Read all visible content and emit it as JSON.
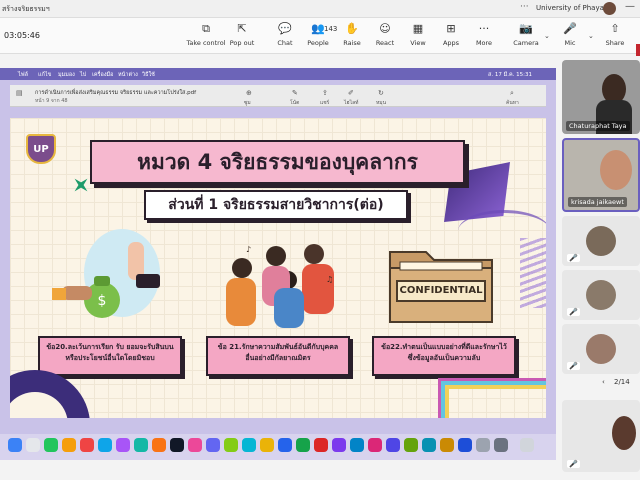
{
  "titlebar": {
    "title": "สร้างจริยธรรมฯ",
    "org": "University of Phayao",
    "more": "···",
    "minimize": "—"
  },
  "meeting": {
    "timer": "03:05:46",
    "tools": [
      {
        "label": "Take control",
        "icon": "take-control-icon",
        "glyph": "⧉"
      },
      {
        "label": "Pop out",
        "icon": "pop-out-icon",
        "glyph": "⇱"
      },
      {
        "label": "Chat",
        "icon": "chat-icon",
        "glyph": "💬"
      },
      {
        "label": "People",
        "icon": "people-icon",
        "glyph": "👥",
        "count": "143"
      },
      {
        "label": "Raise",
        "icon": "raise-hand-icon",
        "glyph": "✋"
      },
      {
        "label": "React",
        "icon": "react-icon",
        "glyph": "☺"
      },
      {
        "label": "View",
        "icon": "view-icon",
        "glyph": "▦"
      },
      {
        "label": "Apps",
        "icon": "apps-icon",
        "glyph": "⊞"
      },
      {
        "label": "More",
        "icon": "more-icon",
        "glyph": "···"
      },
      {
        "label": "Camera",
        "icon": "camera-icon",
        "glyph": "📷"
      },
      {
        "label": "Mic",
        "icon": "mic-icon",
        "glyph": "🎤"
      },
      {
        "label": "Share",
        "icon": "share-icon",
        "glyph": "⇧"
      }
    ]
  },
  "mac_menu": {
    "items": [
      "ไฟล์",
      "แก้ไข",
      "มุมมอง",
      "ไป",
      "เครื่องมือ",
      "หน้าต่าง",
      "วิธีใช้"
    ],
    "clock": "ส. 17 มี.ค. 15:31"
  },
  "viewer": {
    "filename": "การดำเนินการเพื่อส่งเสริมคุณธรรม จริยธรรม และความโปร่งใส.pdf",
    "page": "หน้า 9 จาก 48",
    "tools": [
      "ซูม",
      "โน้ต",
      "แชร์",
      "ไฮไลท์",
      "หมุน",
      "ค้นหา"
    ]
  },
  "slide": {
    "logo": "UP",
    "title": "หมวด 4 จริยธรรมของบุคลากร",
    "subtitle": "ส่วนที่ 1 จริยธรรมสายวิชาการ(ต่อ)",
    "confidential": "CONFIDENTIAL",
    "cards": [
      "ข้อ20.ละเว้นการเรียก รับ ยอมจะรับสินบนหรือประโยชน์อื่นใดโดยมิชอบ",
      "ข้อ 21.รักษาความสัมพันธ์อันดีกับบุคคลอื่นอย่างมีกัลยาณมิตร",
      "ข้อ22.ทำตนเป็นแบบอย่างที่ดีและรักษาไว้ซึ่งข้อมูลอันเป็นความลับ"
    ]
  },
  "gallery": {
    "tiles": [
      {
        "name": "Chaturaphat Taya"
      },
      {
        "name": "krisada jaikaewt"
      }
    ],
    "mic_glyph": "🎤",
    "pager": "2/14",
    "pager_arrow": "‹"
  }
}
